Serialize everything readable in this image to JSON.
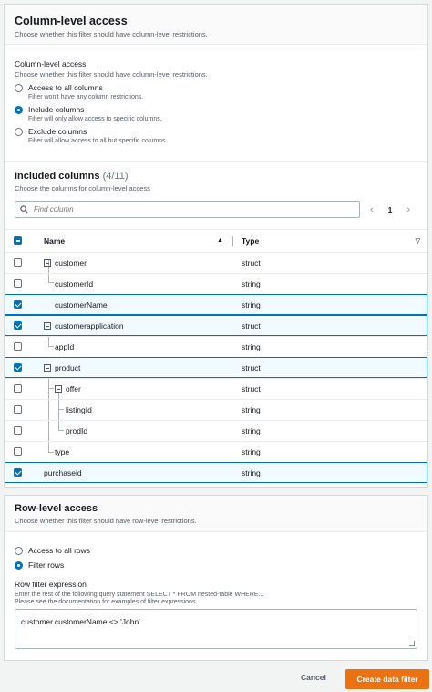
{
  "column_panel": {
    "title": "Column-level access",
    "subtitle": "Choose whether this filter should have column-level restrictions.",
    "field_label": "Column-level access",
    "field_desc": "Choose whether this filter should have column-level restrictions.",
    "options": [
      {
        "title": "Access to all columns",
        "desc": "Filter won't have any column restrictions.",
        "selected": false
      },
      {
        "title": "Include columns",
        "desc": "Filter will only allow access to specific columns.",
        "selected": true
      },
      {
        "title": "Exclude columns",
        "desc": "Filter will allow access to all but specific columns.",
        "selected": false
      }
    ]
  },
  "included_columns": {
    "title": "Included columns",
    "count": "(4/11)",
    "subtitle": "Choose the columns for column-level access",
    "search_placeholder": "Find column",
    "page": "1",
    "headers": {
      "name": "Name",
      "type": "Type"
    },
    "rows": [
      {
        "name": "customer",
        "type": "struct",
        "checked": false
      },
      {
        "name": "customerId",
        "type": "string",
        "checked": false
      },
      {
        "name": "customerName",
        "type": "string",
        "checked": true
      },
      {
        "name": "customerapplication",
        "type": "struct",
        "checked": true
      },
      {
        "name": "appId",
        "type": "string",
        "checked": false
      },
      {
        "name": "product",
        "type": "struct",
        "checked": true
      },
      {
        "name": "offer",
        "type": "struct",
        "checked": false
      },
      {
        "name": "listingId",
        "type": "string",
        "checked": false
      },
      {
        "name": "prodId",
        "type": "string",
        "checked": false
      },
      {
        "name": "type",
        "type": "string",
        "checked": false
      },
      {
        "name": "purchaseid",
        "type": "string",
        "checked": true
      }
    ]
  },
  "row_panel": {
    "title": "Row-level access",
    "subtitle": "Choose whether this filter should have row-level restrictions.",
    "options": [
      {
        "title": "Access to all rows",
        "selected": false
      },
      {
        "title": "Filter rows",
        "selected": true
      }
    ],
    "expr_label": "Row filter expression",
    "expr_desc1": "Enter the rest of the following query statement SELECT * FROM nested-table WHERE...",
    "expr_desc2": "Please see the documentation for examples of filter expressions.",
    "expr_value": "customer.customerName <> 'John'"
  },
  "footer": {
    "cancel_label": "Cancel",
    "create_label": "Create data filter"
  },
  "colors": {
    "accent": "#0073bb",
    "primary_button": "#ec7211"
  }
}
